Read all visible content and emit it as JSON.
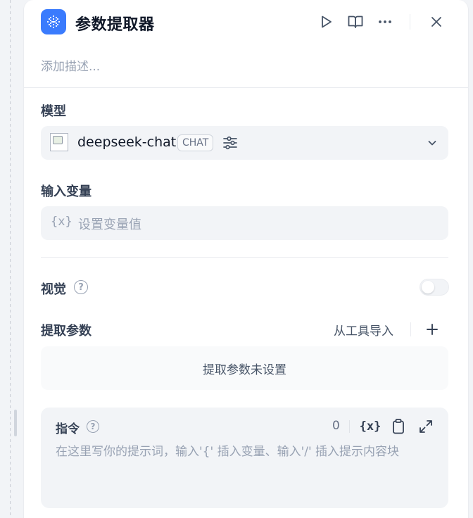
{
  "node": {
    "title": "参数提取器",
    "description_placeholder": "添加描述..."
  },
  "header": {
    "run_icon": "play-icon",
    "docs_icon": "book-open-icon",
    "more_icon": "more-horizontal-icon",
    "close_icon": "close-icon"
  },
  "model": {
    "label": "模型",
    "name": "deepseek-chat",
    "mode_badge": "CHAT"
  },
  "input_variable": {
    "label": "输入变量",
    "icon_text": "{x}",
    "placeholder": "设置变量值"
  },
  "vision": {
    "label": "视觉",
    "enabled": false
  },
  "extract_params": {
    "label": "提取参数",
    "import_label": "从工具导入",
    "empty_text": "提取参数未设置"
  },
  "instruction": {
    "label": "指令",
    "count": "0",
    "var_icon_text": "{x}",
    "placeholder": "在这里写你的提示词，输入'{' 插入变量、输入'/' 插入提示内容块"
  },
  "colors": {
    "accent": "#3a7bfd",
    "panel_bg": "#ffffff",
    "field_bg": "#f2f4f7"
  }
}
